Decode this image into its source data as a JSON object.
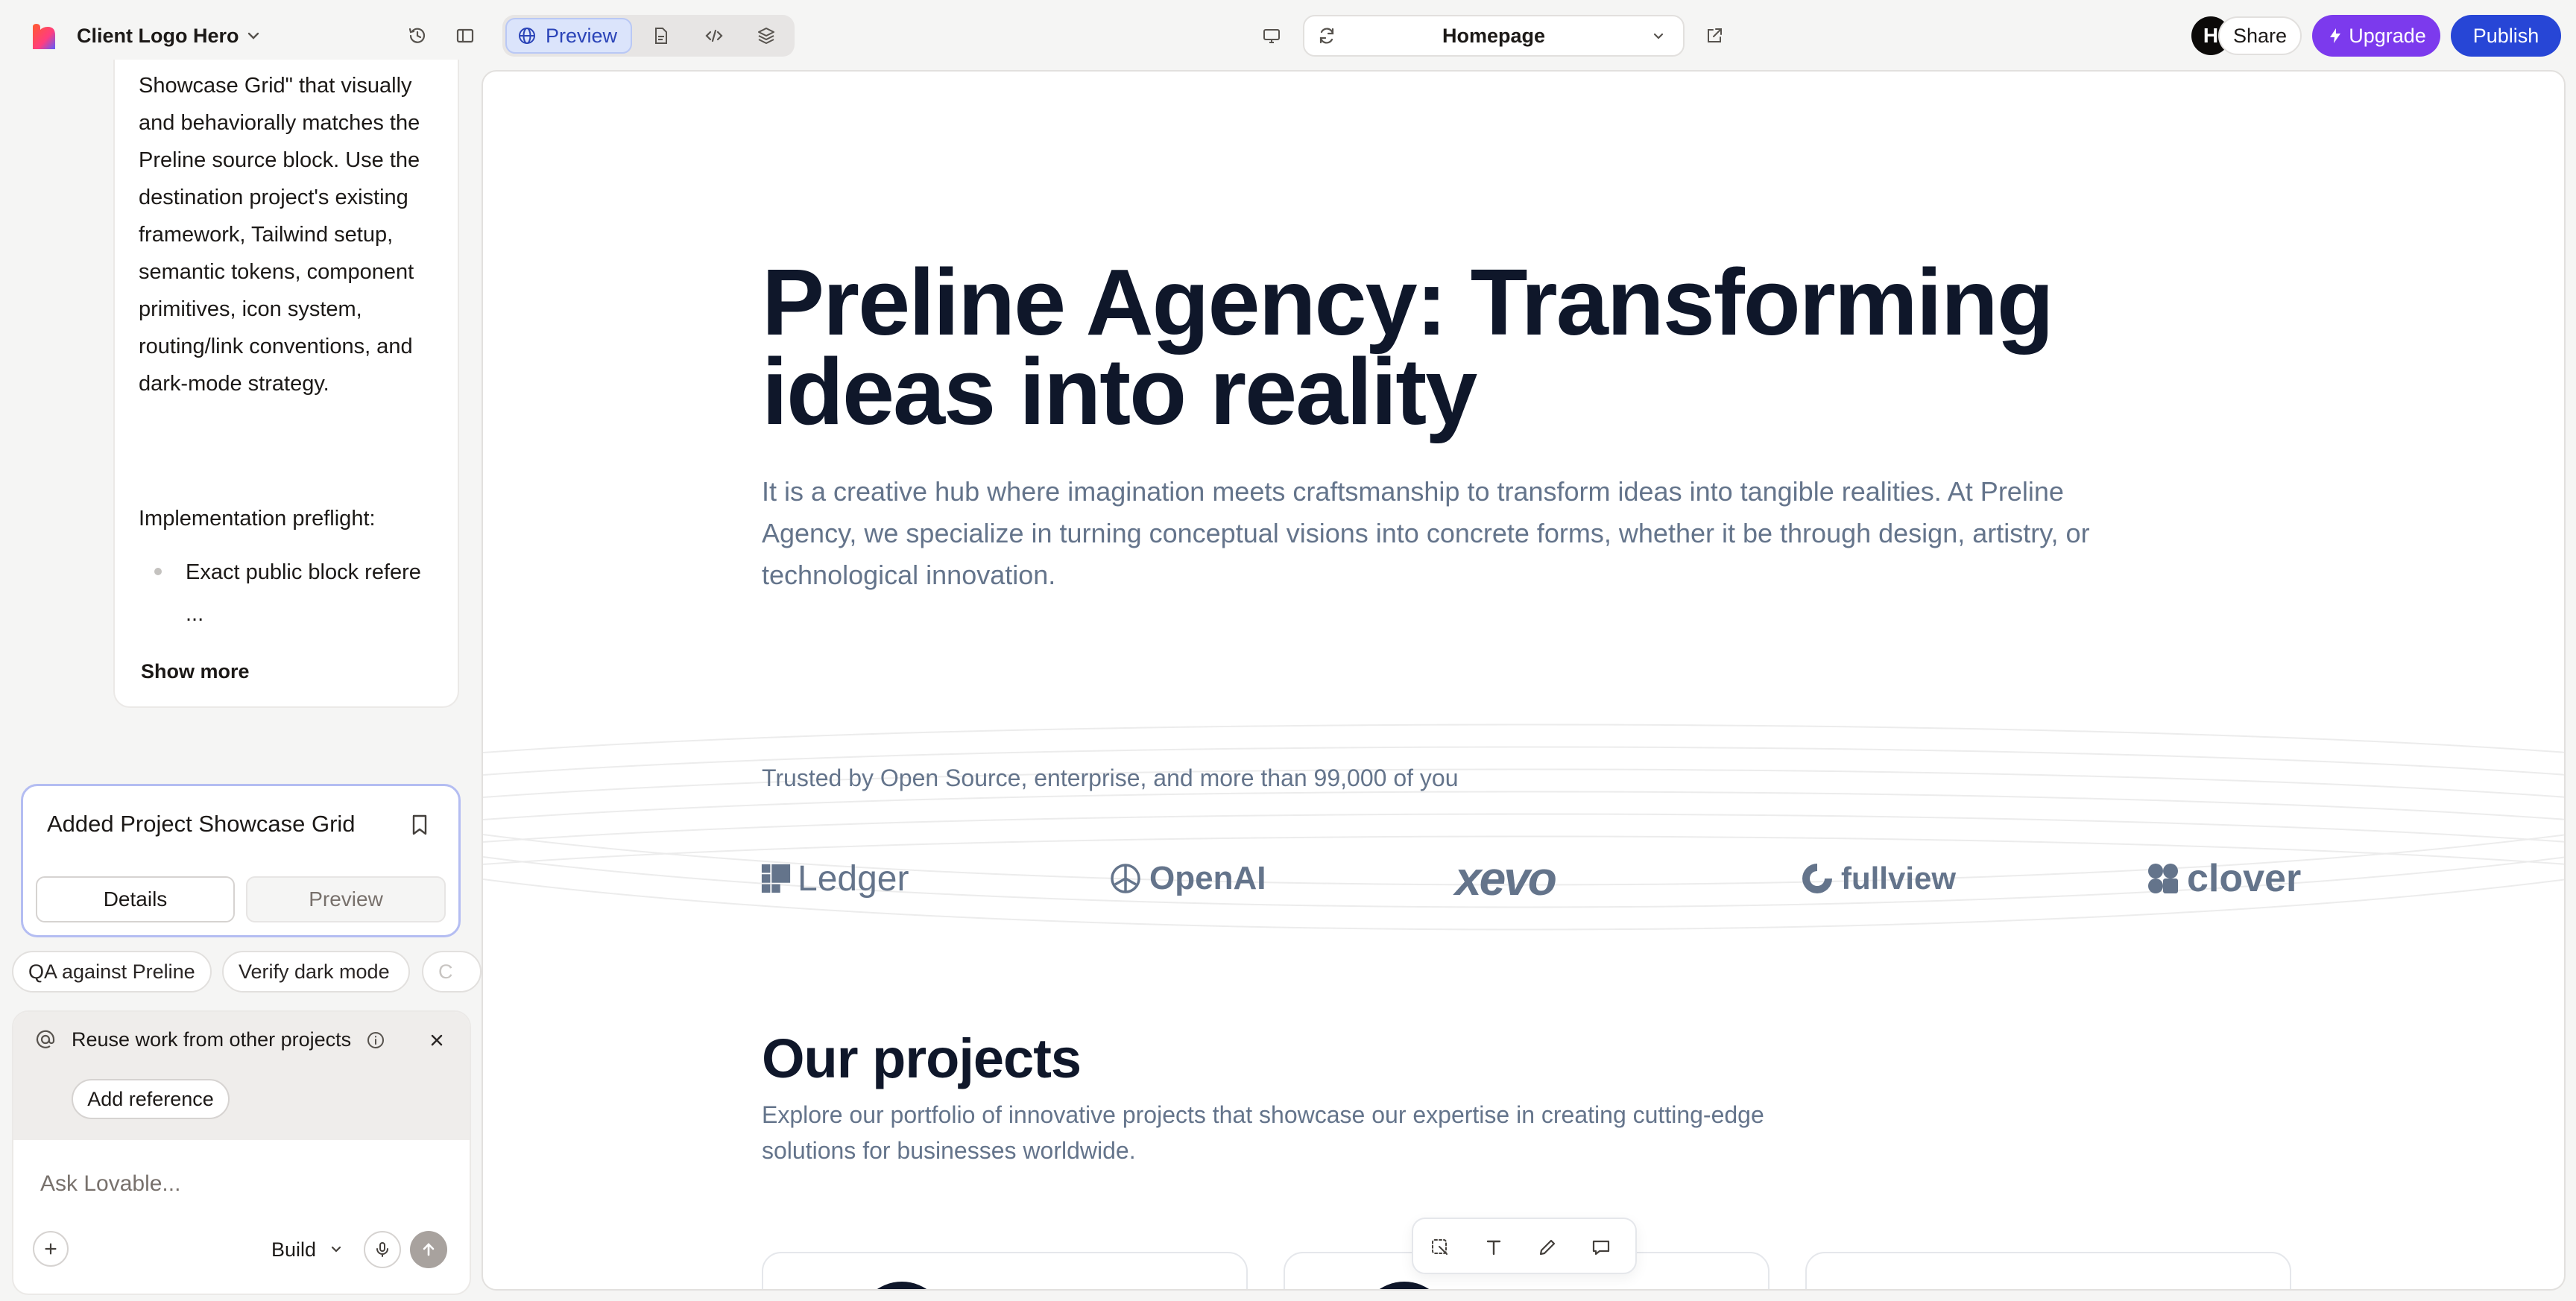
{
  "topbar": {
    "project_title": "Client Logo Hero",
    "preview_label": "Preview",
    "route": "Homepage",
    "avatar_initial": "H",
    "share_label": "Share",
    "upgrade_label": "Upgrade",
    "publish_label": "Publish"
  },
  "chat": {
    "paragraph": "Showcase Grid\" that visually and behaviorally matches the Preline source block. Use the destination project's existing framework, Tailwind setup, semantic tokens, component primitives, icon system, routing/link conventions, and dark-mode strategy.",
    "subheading": "Implementation preflight:",
    "bullet": "Exact public block refere ...",
    "show_more": "Show more"
  },
  "card": {
    "title": "Added Project Showcase Grid",
    "tab_details": "Details",
    "tab_preview": "Preview"
  },
  "chips": [
    "QA against Preline",
    "Verify dark mode",
    "C"
  ],
  "reference": {
    "title": "Reuse work from other projects",
    "add_button": "Add reference"
  },
  "composer": {
    "placeholder": "Ask Lovable...",
    "mode": "Build"
  },
  "site": {
    "hero_title": "Preline Agency: Transforming ideas into reality",
    "hero_desc": "It is a creative hub where imagination meets craftsmanship to transform ideas into tangible realities. At Preline Agency, we specialize in turning conceptual visions into concrete forms, whether it be through design, artistry, or technological innovation.",
    "trusted": "Trusted by Open Source, enterprise, and more than 99,000 of you",
    "logos": [
      "Ledger",
      "OpenAI",
      "xevo",
      "fullview",
      "clover"
    ],
    "projects_title": "Our projects",
    "projects_desc": "Explore our portfolio of innovative projects that showcase our expertise in creating cutting-edge solutions for businesses worldwide."
  },
  "colors": {
    "accent_preview": "#2b44b8",
    "upgrade": "#7c3aed",
    "publish": "#2746d6",
    "heading": "#0f172a",
    "muted": "#64748b"
  }
}
